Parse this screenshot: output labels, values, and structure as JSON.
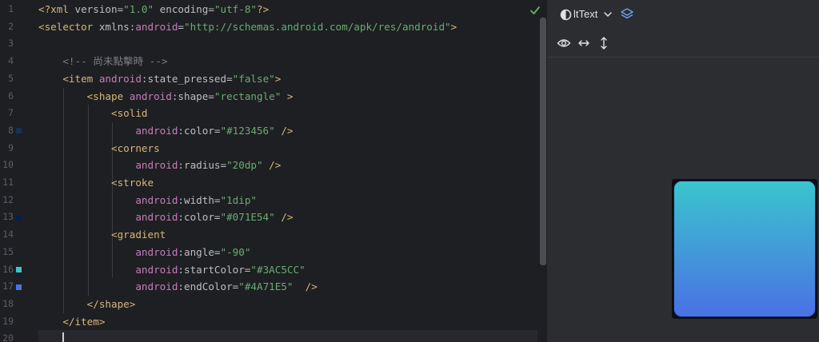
{
  "editor": {
    "line_numbers": [
      "1",
      "2",
      "3",
      "4",
      "5",
      "6",
      "7",
      "8",
      "9",
      "10",
      "11",
      "12",
      "13",
      "14",
      "15",
      "16",
      "17",
      "18",
      "19",
      "20"
    ],
    "lines": [
      {
        "indent": "",
        "tokens": [
          [
            "pi",
            "<?xml "
          ],
          [
            "attr",
            "version"
          ],
          [
            "attr",
            "="
          ],
          [
            "val",
            "\"1.0\""
          ],
          [
            "attr",
            " encoding"
          ],
          [
            "attr",
            "="
          ],
          [
            "val",
            "\"utf-8\""
          ],
          [
            "pi",
            "?>"
          ]
        ]
      },
      {
        "indent": "",
        "tokens": [
          [
            "tag",
            "<selector "
          ],
          [
            "attr",
            "xmlns:"
          ],
          [
            "ns",
            "android"
          ],
          [
            "attr",
            "="
          ],
          [
            "val",
            "\"http://schemas.android.com/apk/res/android\""
          ],
          [
            "tag",
            ">"
          ]
        ]
      },
      {
        "indent": "",
        "tokens": []
      },
      {
        "indent": "    ",
        "tokens": [
          [
            "cmt",
            "<!-- 尚未點擊時 -->"
          ]
        ]
      },
      {
        "indent": "    ",
        "tokens": [
          [
            "tag",
            "<item "
          ],
          [
            "ns",
            "android"
          ],
          [
            "attr",
            ":state_pressed="
          ],
          [
            "val",
            "\"false\""
          ],
          [
            "tag",
            ">"
          ]
        ]
      },
      {
        "indent": "        ",
        "tokens": [
          [
            "tag",
            "<shape "
          ],
          [
            "ns",
            "android"
          ],
          [
            "attr",
            ":shape="
          ],
          [
            "val",
            "\"rectangle\""
          ],
          [
            "tag",
            " >"
          ]
        ]
      },
      {
        "indent": "            ",
        "tokens": [
          [
            "tag",
            "<solid"
          ]
        ]
      },
      {
        "indent": "                ",
        "tokens": [
          [
            "ns",
            "android"
          ],
          [
            "attr",
            ":color="
          ],
          [
            "val",
            "\"#123456\""
          ],
          [
            "tag",
            " />"
          ]
        ]
      },
      {
        "indent": "            ",
        "tokens": [
          [
            "tag",
            "<corners"
          ]
        ]
      },
      {
        "indent": "                ",
        "tokens": [
          [
            "ns",
            "android"
          ],
          [
            "attr",
            ":radius="
          ],
          [
            "val",
            "\"20dp\""
          ],
          [
            "tag",
            " />"
          ]
        ]
      },
      {
        "indent": "            ",
        "tokens": [
          [
            "tag",
            "<stroke"
          ]
        ]
      },
      {
        "indent": "                ",
        "tokens": [
          [
            "ns",
            "android"
          ],
          [
            "attr",
            ":width="
          ],
          [
            "val",
            "\"1dip\""
          ]
        ]
      },
      {
        "indent": "                ",
        "tokens": [
          [
            "ns",
            "android"
          ],
          [
            "attr",
            ":color="
          ],
          [
            "val",
            "\"#071E54\""
          ],
          [
            "tag",
            " />"
          ]
        ]
      },
      {
        "indent": "            ",
        "tokens": [
          [
            "tag",
            "<gradient"
          ]
        ]
      },
      {
        "indent": "                ",
        "tokens": [
          [
            "ns",
            "android"
          ],
          [
            "attr",
            ":angle="
          ],
          [
            "val",
            "\"-90\""
          ]
        ]
      },
      {
        "indent": "                ",
        "tokens": [
          [
            "ns",
            "android"
          ],
          [
            "attr",
            ":startColor="
          ],
          [
            "val",
            "\"#3AC5CC\""
          ]
        ]
      },
      {
        "indent": "                ",
        "tokens": [
          [
            "ns",
            "android"
          ],
          [
            "attr",
            ":endColor="
          ],
          [
            "val",
            "\"#4A71E5\""
          ],
          [
            "tag",
            "  />"
          ]
        ]
      },
      {
        "indent": "        ",
        "tokens": [
          [
            "tag",
            "</shape>"
          ]
        ]
      },
      {
        "indent": "    ",
        "tokens": [
          [
            "tag",
            "</item>"
          ]
        ]
      },
      {
        "indent": "    ",
        "tokens": []
      }
    ],
    "gutter_swatches": [
      {
        "line": 8,
        "color": "#123456"
      },
      {
        "line": 13,
        "color": "#071E54"
      },
      {
        "line": 16,
        "color": "#3AC5CC"
      },
      {
        "line": 17,
        "color": "#4A71E5"
      }
    ],
    "current_line": 20,
    "status_icon": "check-icon"
  },
  "preview": {
    "theme_icon": "contrast-icon",
    "theme_label": "ltText",
    "dropdown_icon": "chevron-down-icon",
    "layers_icon": "layers-icon",
    "toolbar2_icons": [
      "eye-icon",
      "horizontal-arrows-icon",
      "vertical-arrows-icon"
    ],
    "shape": {
      "start_color": "#3AC5CC",
      "end_color": "#4A71E5",
      "stroke_color": "#071E54"
    }
  },
  "colors": {
    "editor_bg": "#1e1f22",
    "panel_bg": "#2b2d30",
    "check": "#5fb865"
  }
}
